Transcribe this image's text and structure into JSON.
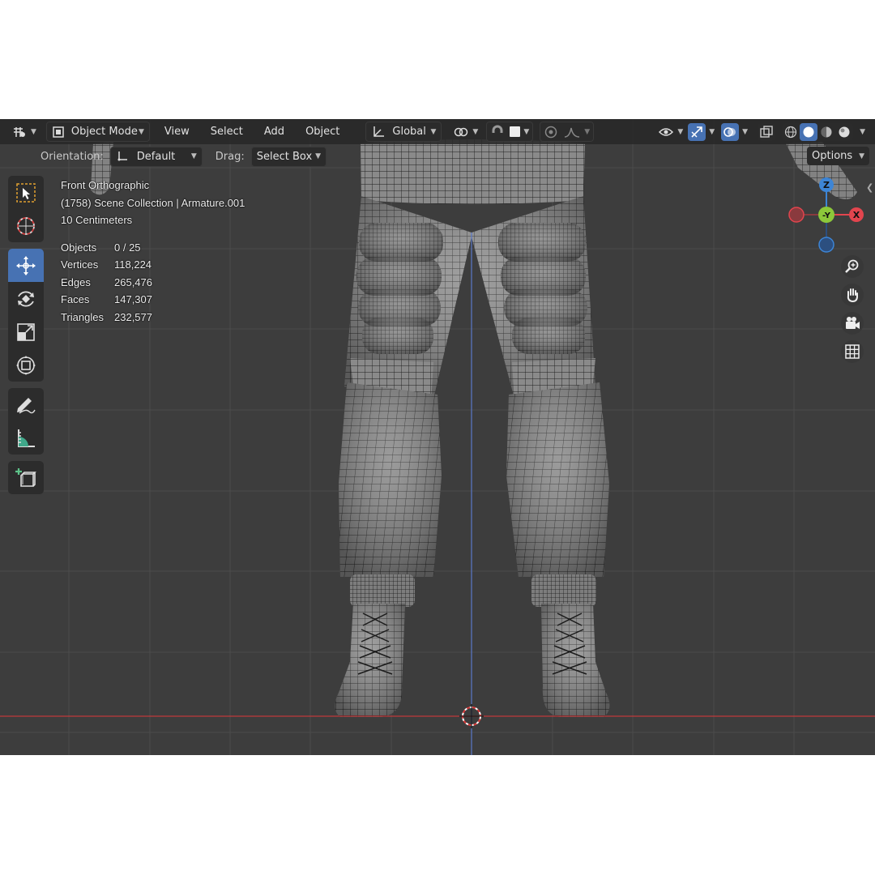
{
  "header": {
    "mode_label": "Object Mode",
    "menu": [
      "View",
      "Select",
      "Add",
      "Object"
    ],
    "transform_orientation": "Global"
  },
  "subheader": {
    "orientation_label": "Orientation:",
    "orientation_value": "Default",
    "drag_label": "Drag:",
    "drag_value": "Select Box",
    "options_label": "Options"
  },
  "overlay": {
    "view_name": "Front Orthographic",
    "collection": "(1758) Scene Collection | Armature.001",
    "scale": "10 Centimeters",
    "stats": [
      {
        "label": "Objects",
        "value": "0 / 25"
      },
      {
        "label": "Vertices",
        "value": "118,224"
      },
      {
        "label": "Edges",
        "value": "265,476"
      },
      {
        "label": "Faces",
        "value": "147,307"
      },
      {
        "label": "Triangles",
        "value": "232,577"
      }
    ]
  },
  "gizmo": {
    "z_label": "Z",
    "y_label": "-Y",
    "x_label": "X"
  },
  "toolbar_tools": [
    "select-box",
    "cursor",
    "move",
    "rotate",
    "scale",
    "transform",
    "annotate",
    "measure",
    "add-cube"
  ],
  "nav_buttons": [
    "zoom",
    "pan",
    "camera",
    "ortho-grid"
  ],
  "colors": {
    "viewport_bg": "#3d3d3d",
    "grid_line": "#4a4a4a",
    "x_axis": "#c0393b",
    "z_axis": "#5a78c8",
    "active_tool": "#4772b3",
    "gizmo_x": "#e2454e",
    "gizmo_y": "#8cc83a",
    "gizmo_z": "#3d85d6"
  }
}
